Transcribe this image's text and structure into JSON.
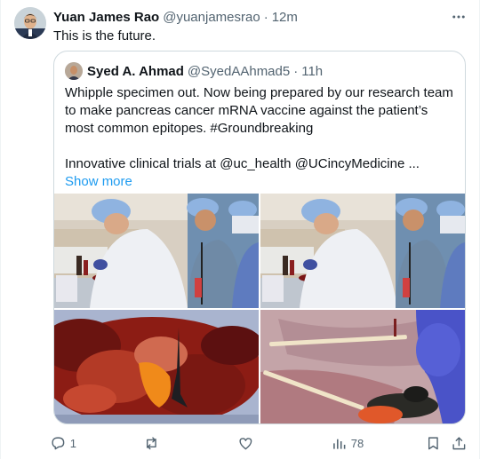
{
  "tweet": {
    "author_name": "Yuan James Rao",
    "author_handle": "@yuanjamesrao",
    "separator": "·",
    "time": "12m",
    "text": "This is the future."
  },
  "quote": {
    "author_name": "Syed A. Ahmad",
    "author_handle": "@SyedAAhmad5",
    "separator": "·",
    "time": "11h",
    "paragraph1": "Whipple specimen out. Now being prepared by our research team to make pancreas cancer mRNA vaccine against the patient’s most common epitopes. #Groundbreaking",
    "paragraph2": "Innovative clinical trials at @uc_health @UCincyMedicine ...",
    "show_more": "Show more"
  },
  "actions": {
    "reply_count": "1",
    "views_count": "78"
  },
  "colors": {
    "text": "#0f1419",
    "secondary": "#536471",
    "link": "#1d9bf0",
    "border": "#cfd9de"
  },
  "icons": [
    "more-icon",
    "reply-icon",
    "retweet-icon",
    "like-icon",
    "views-icon",
    "bookmark-icon",
    "share-icon"
  ]
}
